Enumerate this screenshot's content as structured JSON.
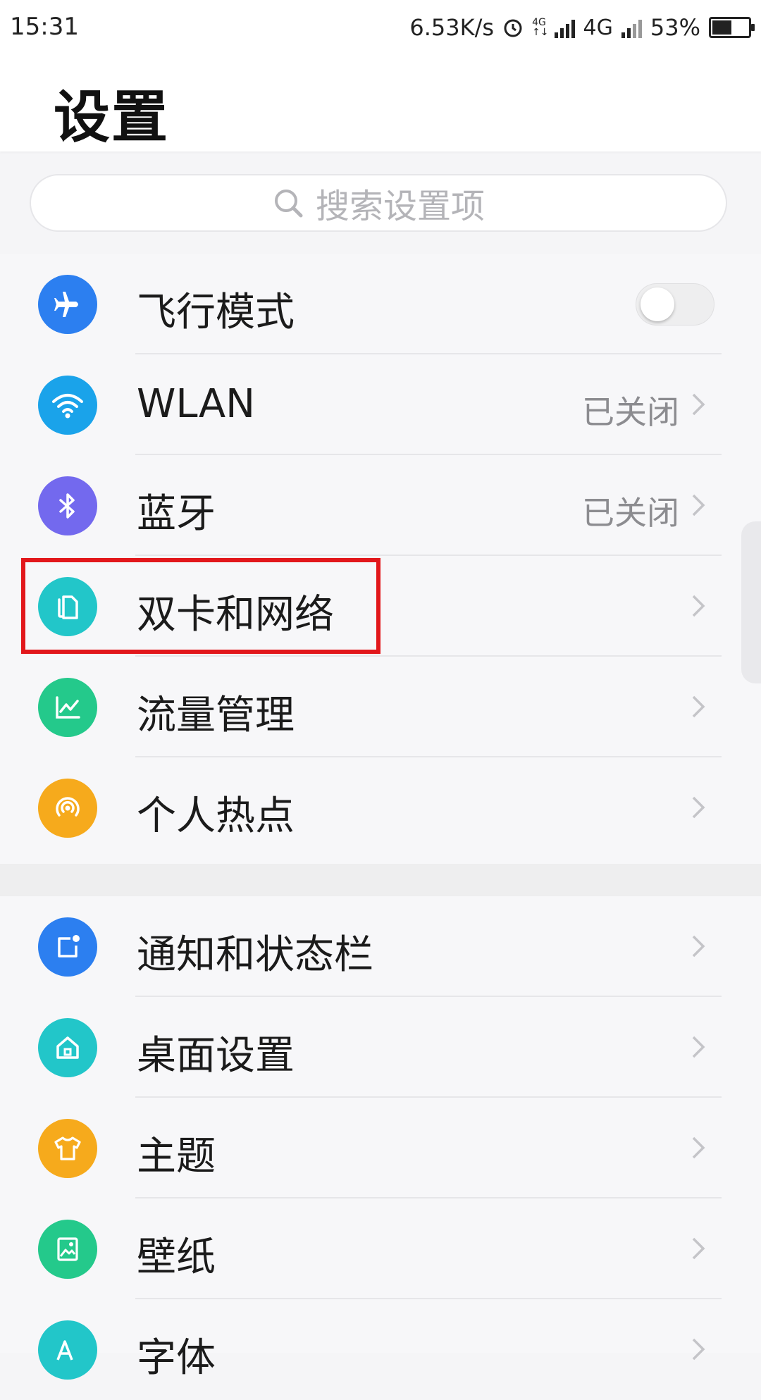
{
  "status_bar": {
    "time": "15:31",
    "speed": "6.53K/s",
    "net1_small": "4G",
    "net1_small2": "↑↓",
    "net2": "4G",
    "battery": "53%",
    "battery_level": 0.53,
    "alarm_icon": "alarm-clock-icon"
  },
  "header": {
    "title": "设置"
  },
  "search": {
    "placeholder": "搜索设置项",
    "icon": "search-icon"
  },
  "colors": {
    "blue": "#2c7ff0",
    "wifi_blue": "#1aa3ea",
    "purple": "#7369ee",
    "teal": "#22c6c9",
    "green": "#24c98b",
    "orange": "#f6aa1c",
    "highlight_red": "#e2171b"
  },
  "section1": [
    {
      "label": "飞行模式",
      "icon": "airplane-icon",
      "control": "toggle",
      "toggle_on": false
    },
    {
      "label": "WLAN",
      "icon": "wifi-icon",
      "value": "已关闭"
    },
    {
      "label": "蓝牙",
      "icon": "bluetooth-icon",
      "value": "已关闭"
    },
    {
      "label": "双卡和网络",
      "icon": "dual-sim-icon"
    },
    {
      "label": "流量管理",
      "icon": "data-usage-icon"
    },
    {
      "label": "个人热点",
      "icon": "hotspot-icon"
    }
  ],
  "section2": [
    {
      "label": "通知和状态栏",
      "icon": "notification-icon"
    },
    {
      "label": "桌面设置",
      "icon": "home-icon"
    },
    {
      "label": "主题",
      "icon": "theme-shirt-icon"
    },
    {
      "label": "壁纸",
      "icon": "wallpaper-icon"
    },
    {
      "label": "字体",
      "icon": "font-icon"
    }
  ]
}
